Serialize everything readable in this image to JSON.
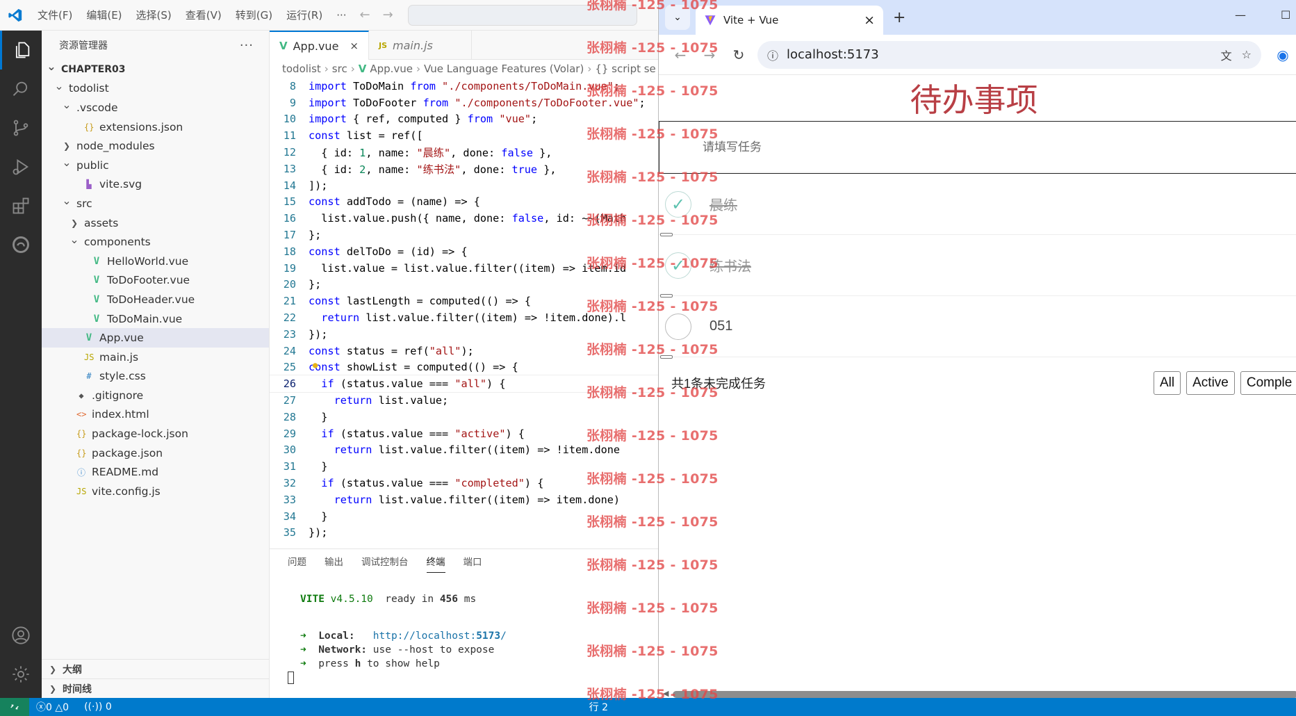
{
  "vscode": {
    "menu": [
      "文件(F)",
      "编辑(E)",
      "选择(S)",
      "查看(V)",
      "转到(G)",
      "运行(R)",
      "···"
    ],
    "explorer_title": "资源管理器",
    "more": "···",
    "tree": [
      {
        "label": "CHAPTER03",
        "indent": 0,
        "chev": "down",
        "icon": "",
        "bold": true
      },
      {
        "label": "todolist",
        "indent": 1,
        "chev": "down",
        "icon": ""
      },
      {
        "label": ".vscode",
        "indent": 2,
        "chev": "down",
        "icon": ""
      },
      {
        "label": "extensions.json",
        "indent": 3,
        "chev": "",
        "icon": "json"
      },
      {
        "label": "node_modules",
        "indent": 2,
        "chev": "right",
        "icon": ""
      },
      {
        "label": "public",
        "indent": 2,
        "chev": "down",
        "icon": ""
      },
      {
        "label": "vite.svg",
        "indent": 3,
        "chev": "",
        "icon": "svg"
      },
      {
        "label": "src",
        "indent": 2,
        "chev": "down",
        "icon": ""
      },
      {
        "label": "assets",
        "indent": 3,
        "chev": "right",
        "icon": ""
      },
      {
        "label": "components",
        "indent": 3,
        "chev": "down",
        "icon": ""
      },
      {
        "label": "HelloWorld.vue",
        "indent": 4,
        "chev": "",
        "icon": "vue"
      },
      {
        "label": "ToDoFooter.vue",
        "indent": 4,
        "chev": "",
        "icon": "vue"
      },
      {
        "label": "ToDoHeader.vue",
        "indent": 4,
        "chev": "",
        "icon": "vue"
      },
      {
        "label": "ToDoMain.vue",
        "indent": 4,
        "chev": "",
        "icon": "vue"
      },
      {
        "label": "App.vue",
        "indent": 3,
        "chev": "",
        "icon": "vue",
        "selected": true
      },
      {
        "label": "main.js",
        "indent": 3,
        "chev": "",
        "icon": "js"
      },
      {
        "label": "style.css",
        "indent": 3,
        "chev": "",
        "icon": "css"
      },
      {
        "label": ".gitignore",
        "indent": 2,
        "chev": "",
        "icon": "git"
      },
      {
        "label": "index.html",
        "indent": 2,
        "chev": "",
        "icon": "html"
      },
      {
        "label": "package-lock.json",
        "indent": 2,
        "chev": "",
        "icon": "json"
      },
      {
        "label": "package.json",
        "indent": 2,
        "chev": "",
        "icon": "json"
      },
      {
        "label": "README.md",
        "indent": 2,
        "chev": "",
        "icon": "info"
      },
      {
        "label": "vite.config.js",
        "indent": 2,
        "chev": "",
        "icon": "js"
      }
    ],
    "outline_label": "大纲",
    "timeline_label": "时间线",
    "tabs": [
      {
        "label": "App.vue",
        "active": true,
        "close": "×"
      },
      {
        "label": "main.js",
        "active": false,
        "close": ""
      }
    ],
    "breadcrumb": [
      "todolist",
      "src",
      "App.vue",
      "Vue Language Features (Volar)",
      "{} script se"
    ],
    "code_lines": [
      {
        "n": "8",
        "text": "import ToDoMain from \"./components/ToDoMain.vue\";"
      },
      {
        "n": "9",
        "text": "import ToDoFooter from \"./components/ToDoFooter.vue\";"
      },
      {
        "n": "10",
        "text": "import { ref, computed } from \"vue\";"
      },
      {
        "n": "11",
        "text": "const list = ref(["
      },
      {
        "n": "12",
        "text": "  { id: 1, name: \"晨练\", done: false },"
      },
      {
        "n": "13",
        "text": "  { id: 2, name: \"练书法\", done: true },"
      },
      {
        "n": "14",
        "text": "]);"
      },
      {
        "n": "15",
        "text": "const addTodo = (name) => {"
      },
      {
        "n": "16",
        "text": "  list.value.push({ name, done: false, id: ~~(Math"
      },
      {
        "n": "17",
        "text": "};"
      },
      {
        "n": "18",
        "text": "const delToDo = (id) => {"
      },
      {
        "n": "19",
        "text": "  list.value = list.value.filter((item) => item.id"
      },
      {
        "n": "20",
        "text": "};"
      },
      {
        "n": "21",
        "text": "const lastLength = computed(() => {"
      },
      {
        "n": "22",
        "text": "  return list.value.filter((item) => !item.done).l"
      },
      {
        "n": "23",
        "text": "});"
      },
      {
        "n": "24",
        "text": "const status = ref(\"all\");"
      },
      {
        "n": "25",
        "text": "const showList = computed(() => {"
      },
      {
        "n": "26",
        "text": "  if (status.value === \"all\") {",
        "current": true
      },
      {
        "n": "27",
        "text": "    return list.value;"
      },
      {
        "n": "28",
        "text": "  }"
      },
      {
        "n": "29",
        "text": "  if (status.value === \"active\") {"
      },
      {
        "n": "30",
        "text": "    return list.value.filter((item) => !item.done"
      },
      {
        "n": "31",
        "text": "  }"
      },
      {
        "n": "32",
        "text": "  if (status.value === \"completed\") {"
      },
      {
        "n": "33",
        "text": "    return list.value.filter((item) => item.done)"
      },
      {
        "n": "34",
        "text": "  }"
      },
      {
        "n": "35",
        "text": "});"
      }
    ],
    "panel_tabs": [
      {
        "label": "问题",
        "active": false
      },
      {
        "label": "输出",
        "active": false
      },
      {
        "label": "调试控制台",
        "active": false
      },
      {
        "label": "终端",
        "active": true
      },
      {
        "label": "端口",
        "active": false
      }
    ],
    "terminal": {
      "vite": "VITE",
      "version": "v4.5.10",
      "ready": "ready in",
      "ms_value": "456",
      "ms_unit": "ms",
      "arrow": "➜",
      "local_label": "Local:",
      "local_url_prefix": "http://localhost:",
      "local_port": "5173",
      "local_url_suffix": "/",
      "network_label": "Network:",
      "network_text": "use --host to expose",
      "help_prefix": "press",
      "help_key": "h",
      "help_suffix": "to show help"
    },
    "status": {
      "errors": "0",
      "warnings": "0",
      "ports": "0",
      "position": "行 2"
    }
  },
  "browser": {
    "tab_title": "Vite + Vue",
    "tab_close": "×",
    "new_tab": "+",
    "url": "localhost:5173",
    "min": "—",
    "max": "☐"
  },
  "app": {
    "title": "待办事项",
    "input_placeholder": "请填写任务",
    "todos": [
      {
        "label": "晨练",
        "done": true
      },
      {
        "label": "练书法",
        "done": true
      },
      {
        "label": "051",
        "done": false
      }
    ],
    "footer_count": "共1条未完成任务",
    "filters": [
      "All",
      "Active",
      "Comple"
    ]
  },
  "watermark": "张栩楠 -125 - 1075",
  "colors": {
    "vscode_accent": "#0078d4",
    "statusbar": "#007acc",
    "keyword": "#0000ff",
    "string": "#a31515",
    "todo_title": "#b83f45",
    "check": "#5dc2af"
  }
}
